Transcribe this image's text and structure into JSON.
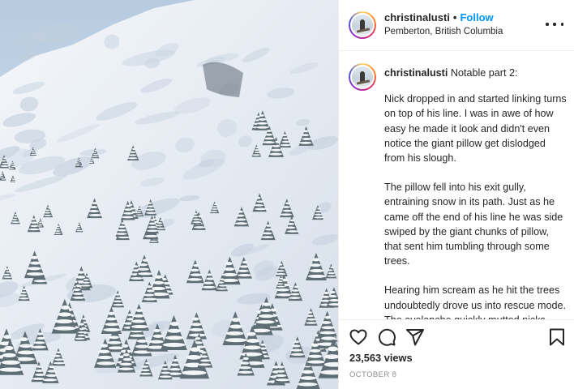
{
  "post": {
    "username": "christinalusti",
    "follow_label": "Follow",
    "separator": "•",
    "location": "Pemberton, British Columbia",
    "media_icon": "snowy-mountain-photo"
  },
  "caption": {
    "username": "christinalusti",
    "title": "Notable part 2:",
    "paragraphs": [
      "Nick dropped in and started linking turns on top of his line. I was in awe of how easy he made it look and didn't even notice the giant pillow get dislodged from his slough.",
      "The pillow fell into his exit gully, entraining snow in its path. Just as he came off the end of his line he was side swiped by the giant chunks of pillow, that sent him tumbling through some trees.",
      "Hearing him scream as he hit the trees undoubtedly drove us into rescue mode. The avalanche quickly mutted nicks screams as it pushed him deep under the snow. I felt a huge weight of"
    ]
  },
  "stats": {
    "views": "23,563 views",
    "date": "OCTOBER 8"
  },
  "icons": {
    "more": "more-options-icon",
    "like": "heart-icon",
    "comment": "comment-icon",
    "share": "share-icon",
    "save": "bookmark-icon"
  },
  "colors": {
    "accent": "#0095f6",
    "text": "#262626",
    "muted": "#8e8e8e",
    "border": "#efefef"
  }
}
